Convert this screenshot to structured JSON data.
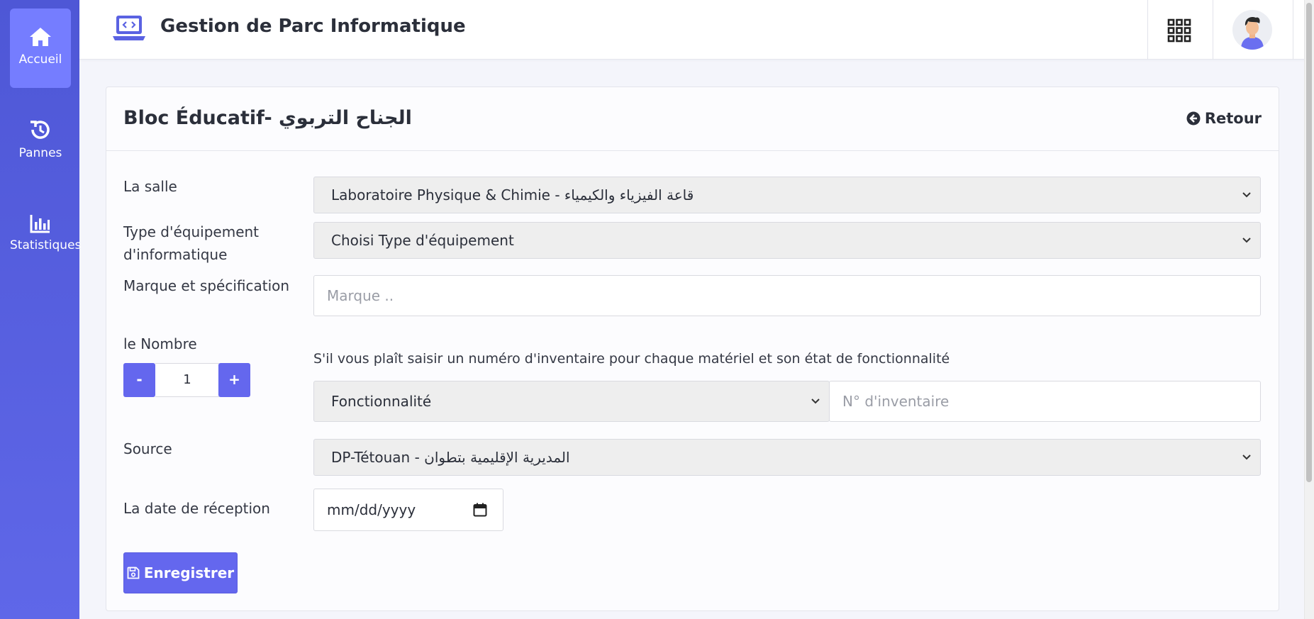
{
  "app": {
    "title": "Gestion de Parc Informatique"
  },
  "sidebar": {
    "items": [
      {
        "label": "Accueil",
        "icon": "home-icon",
        "active": true
      },
      {
        "label": "Pannes",
        "icon": "history-icon",
        "active": false
      },
      {
        "label": "Statistiques",
        "icon": "bar-chart-icon",
        "active": false
      }
    ]
  },
  "card": {
    "title": "Bloc Éducatif- الجناح التربوي",
    "back_label": "Retour"
  },
  "form": {
    "salle": {
      "label": "La salle",
      "value": "Laboratoire Physique & Chimie - قاعة الفيزياء والكيمياء"
    },
    "type": {
      "label": "Type d'équipement d'informatique",
      "value": "Choisi Type d'équipement"
    },
    "marque": {
      "label": "Marque et spécification",
      "placeholder": "Marque .."
    },
    "nombre": {
      "label": "le Nombre",
      "value": "1",
      "minus": "-",
      "plus": "+"
    },
    "inventaire": {
      "hint": "S'il vous plaît saisir un numéro d'inventaire pour chaque matériel et son état de fonctionnalité",
      "fonctionnalite": "Fonctionnalité",
      "placeholder": "N° d'inventaire"
    },
    "source": {
      "label": "Source",
      "value": "DP-Tétouan - المديرية الإقليمية بتطوان"
    },
    "date": {
      "label": "La date de réception",
      "placeholder": "mm/dd/yyyy"
    },
    "save_label": "Enregistrer"
  },
  "colors": {
    "sidebar": "#5a62e2",
    "sidebar_active": "#757dff",
    "primary_button": "#6467ee",
    "select_bg": "#eeeeee"
  }
}
